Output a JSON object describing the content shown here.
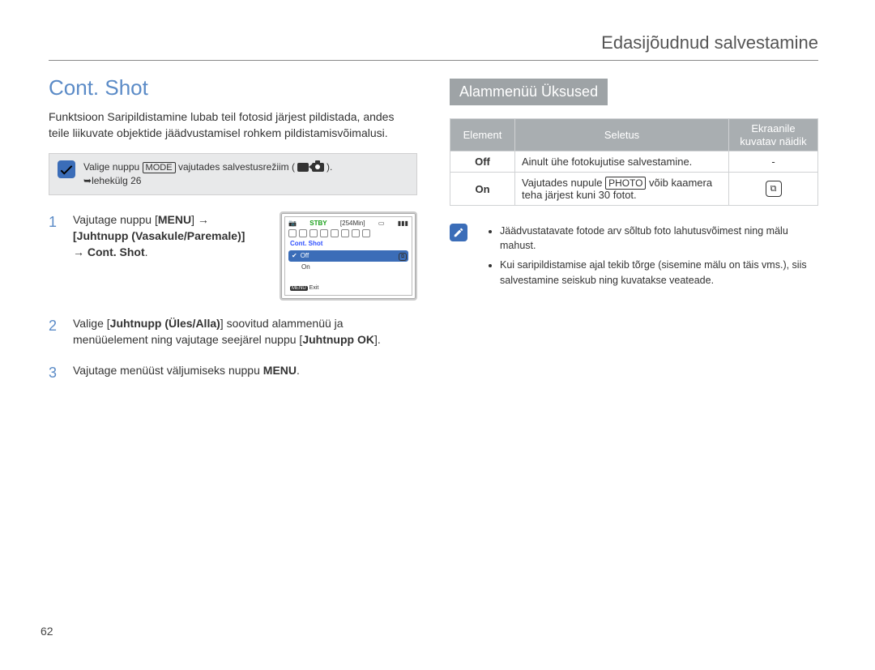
{
  "header": {
    "title": "Edasijõudnud salvestamine"
  },
  "left": {
    "section_title": "Cont. Shot",
    "intro": "Funktsioon Saripildistamine lubab teil fotosid järjest pildistada, andes teile liikuvate objektide jäädvustamisel rohkem pildistamisvõimalusi.",
    "callout": {
      "icon_name": "check-icon",
      "text_prefix": "Valige nuppu ",
      "mode_label": "MODE",
      "text_mid": " vajutades salvestusrežiim ( ",
      "text_suffix": " ).",
      "page_ref": "lehekülg 26"
    },
    "steps": [
      {
        "num": "1",
        "text_a": "Vajutage nuppu [",
        "menu_label": "MENU",
        "text_b": "] →",
        "line2_label": "[Juhtnupp (Vasakule/Paremale)]",
        "line3": "→ ",
        "line3_bold": "Cont. Shot",
        "line3_end": "."
      },
      {
        "num": "2",
        "text_a": "Valige [",
        "bold_a": "Juhtnupp (Üles/Alla)",
        "text_b": "] soovitud alammenüü ja menüüelement ning vajutage seejärel nuppu [",
        "bold_b": "Juhtnupp OK",
        "text_c": "]."
      },
      {
        "num": "3",
        "text_a": "Vajutage menüüst väljumiseks nuppu ",
        "menu_label": "MENU",
        "text_b": "."
      }
    ],
    "lcd": {
      "stby": "STBY",
      "time": "[254Min]",
      "menu_title": "Cont. Shot",
      "off": "Off",
      "on": "On",
      "menu_key": "MENU",
      "exit": "Exit"
    }
  },
  "right": {
    "subtitle": "Alammenüü Üksused",
    "table": {
      "headers": {
        "element": "Element",
        "desc": "Seletus",
        "indicator": "Ekraanile kuvatav näidik"
      },
      "rows": [
        {
          "element": "Off",
          "desc": "Ainult ühe fotokujutise salvestamine.",
          "indicator": "-",
          "has_icon": false
        },
        {
          "element": "On",
          "desc_a": "Vajutades nupule ",
          "photo_label": "PHOTO",
          "desc_b": " võib kaamera teha järjest kuni 30 fotot.",
          "has_icon": true,
          "icon_glyph": "⧉"
        }
      ]
    },
    "notes": {
      "icon_name": "pencil-icon",
      "items": [
        "Jäädvustatavate fotode arv sõltub foto lahutusvõimest ning mälu mahust.",
        "Kui saripildistamise ajal tekib tõrge (sisemine mälu on täis vms.), siis salvestamine seiskub ning kuvatakse veateade."
      ]
    }
  },
  "page_number": "62"
}
